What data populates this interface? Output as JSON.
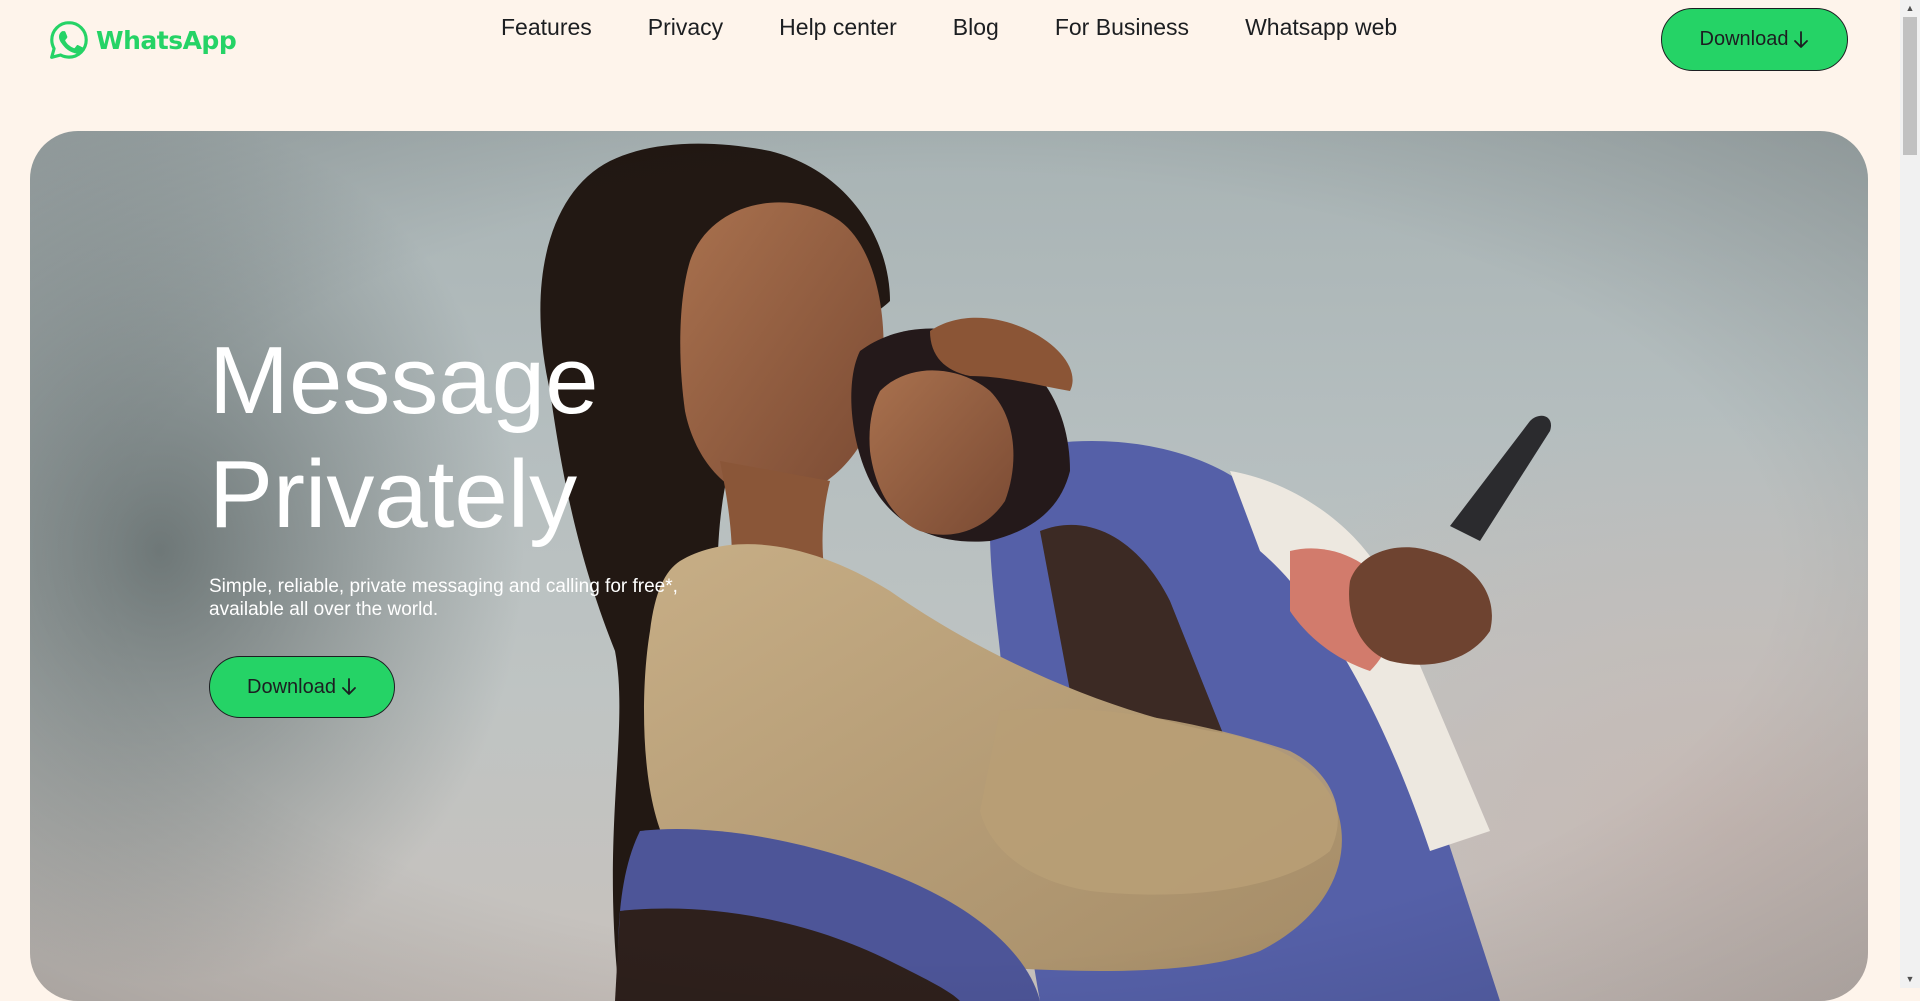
{
  "brand": {
    "name": "WhatsApp",
    "icon": "whatsapp-logo-icon",
    "color": "#25D366"
  },
  "nav": {
    "items": [
      {
        "label": "Features"
      },
      {
        "label": "Privacy"
      },
      {
        "label": "Help center"
      },
      {
        "label": "Blog"
      },
      {
        "label": "For Business"
      },
      {
        "label": "Whatsapp web"
      }
    ]
  },
  "header": {
    "download_label": "Download",
    "download_icon": "arrow-down-icon"
  },
  "hero": {
    "title_line1": "Message",
    "title_line2": "Privately",
    "subtitle": "Simple, reliable, private messaging and calling for free*, available all over the world.",
    "download_label": "Download",
    "download_icon": "arrow-down-icon",
    "image": "photo of a woman hugging a girl holding a phone"
  },
  "colors": {
    "page_background": "#FEF4EB",
    "accent_green": "#25D366",
    "text_dark": "#1C1E21"
  }
}
